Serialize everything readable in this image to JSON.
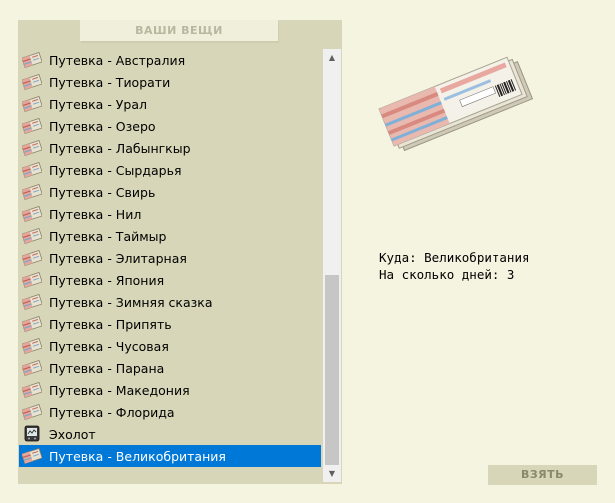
{
  "inventory": {
    "title": "ВАШИ ВЕЩИ",
    "items": [
      {
        "label": "Путевка - Австралия",
        "icon": "ticket-icon"
      },
      {
        "label": "Путевка - Тиорати",
        "icon": "ticket-icon"
      },
      {
        "label": "Путевка - Урал",
        "icon": "ticket-icon"
      },
      {
        "label": "Путевка - Озеро",
        "icon": "ticket-icon"
      },
      {
        "label": "Путевка - Лабынгкыр",
        "icon": "ticket-icon"
      },
      {
        "label": "Путевка - Сырдарья",
        "icon": "ticket-icon"
      },
      {
        "label": "Путевка - Свирь",
        "icon": "ticket-icon"
      },
      {
        "label": "Путевка - Нил",
        "icon": "ticket-icon"
      },
      {
        "label": "Путевка - Таймыр",
        "icon": "ticket-icon"
      },
      {
        "label": "Путевка - Элитарная",
        "icon": "ticket-icon"
      },
      {
        "label": "Путевка - Япония",
        "icon": "ticket-icon"
      },
      {
        "label": "Путевка - Зимняя сказка",
        "icon": "ticket-icon"
      },
      {
        "label": "Путевка - Припять",
        "icon": "ticket-icon"
      },
      {
        "label": "Путевка - Чусовая",
        "icon": "ticket-icon"
      },
      {
        "label": "Путевка - Парана",
        "icon": "ticket-icon"
      },
      {
        "label": "Путевка - Македония",
        "icon": "ticket-icon"
      },
      {
        "label": "Путевка - Флорида",
        "icon": "ticket-icon"
      },
      {
        "label": "Эхолот",
        "icon": "echo-sounder-icon"
      },
      {
        "label": "Путевка - Великобритания",
        "icon": "ticket-icon"
      }
    ],
    "selected_index": 18,
    "selected_color": "#0078d7"
  },
  "details": {
    "destination_line": "Куда: Великобритания",
    "days_line": "На сколько дней: 3",
    "preview_icon": "ticket-bundle-icon"
  },
  "actions": {
    "take_label": "ВЗЯТЬ"
  }
}
